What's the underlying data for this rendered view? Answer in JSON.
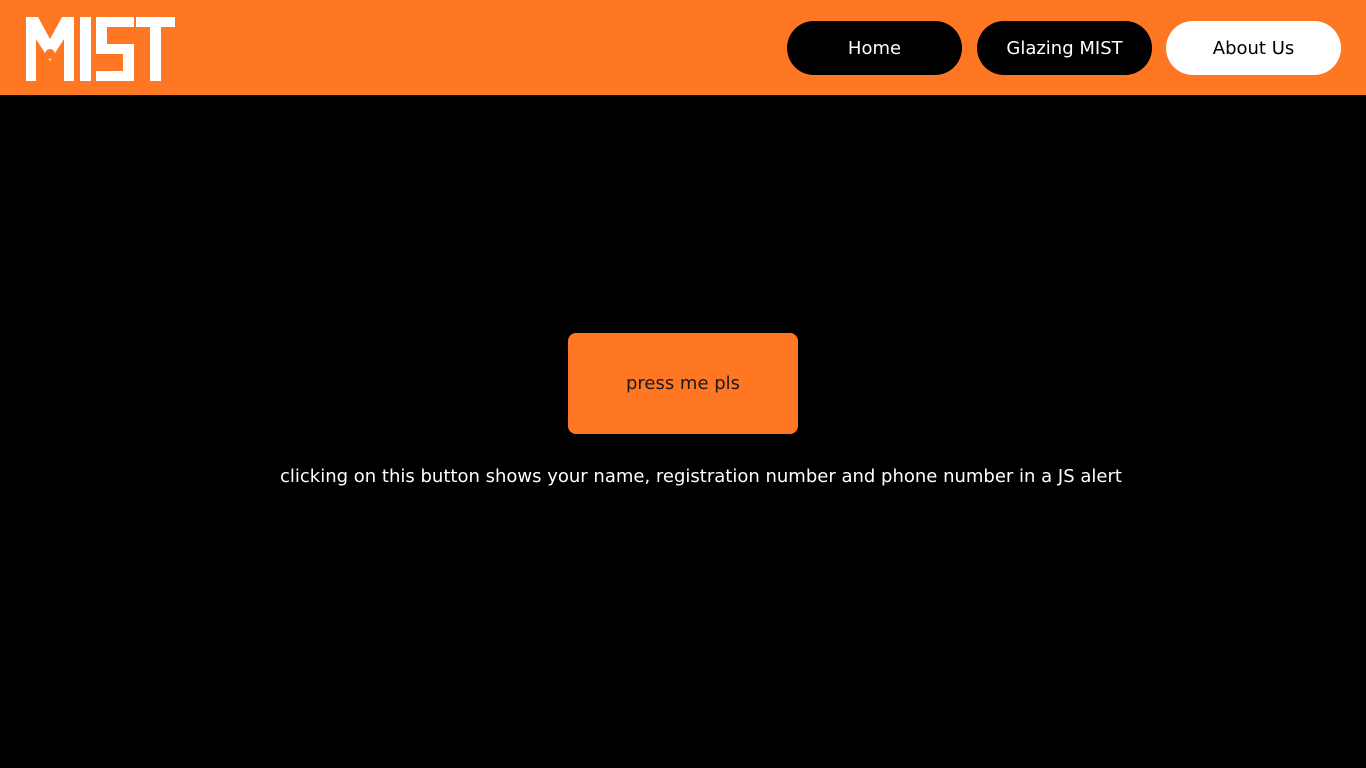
{
  "header": {
    "logo": {
      "text": "MIST",
      "icon": "person-at-desk-icon"
    },
    "nav": {
      "home_label": "Home",
      "glazing_label": "Glazing MIST",
      "about_label": "About Us"
    }
  },
  "main": {
    "button_label": "press me pls",
    "caption": "clicking on this button shows your name, registration number and phone number in a JS alert"
  },
  "colors": {
    "accent": "#FF7722",
    "background": "#000000",
    "text_light": "#ffffff"
  }
}
